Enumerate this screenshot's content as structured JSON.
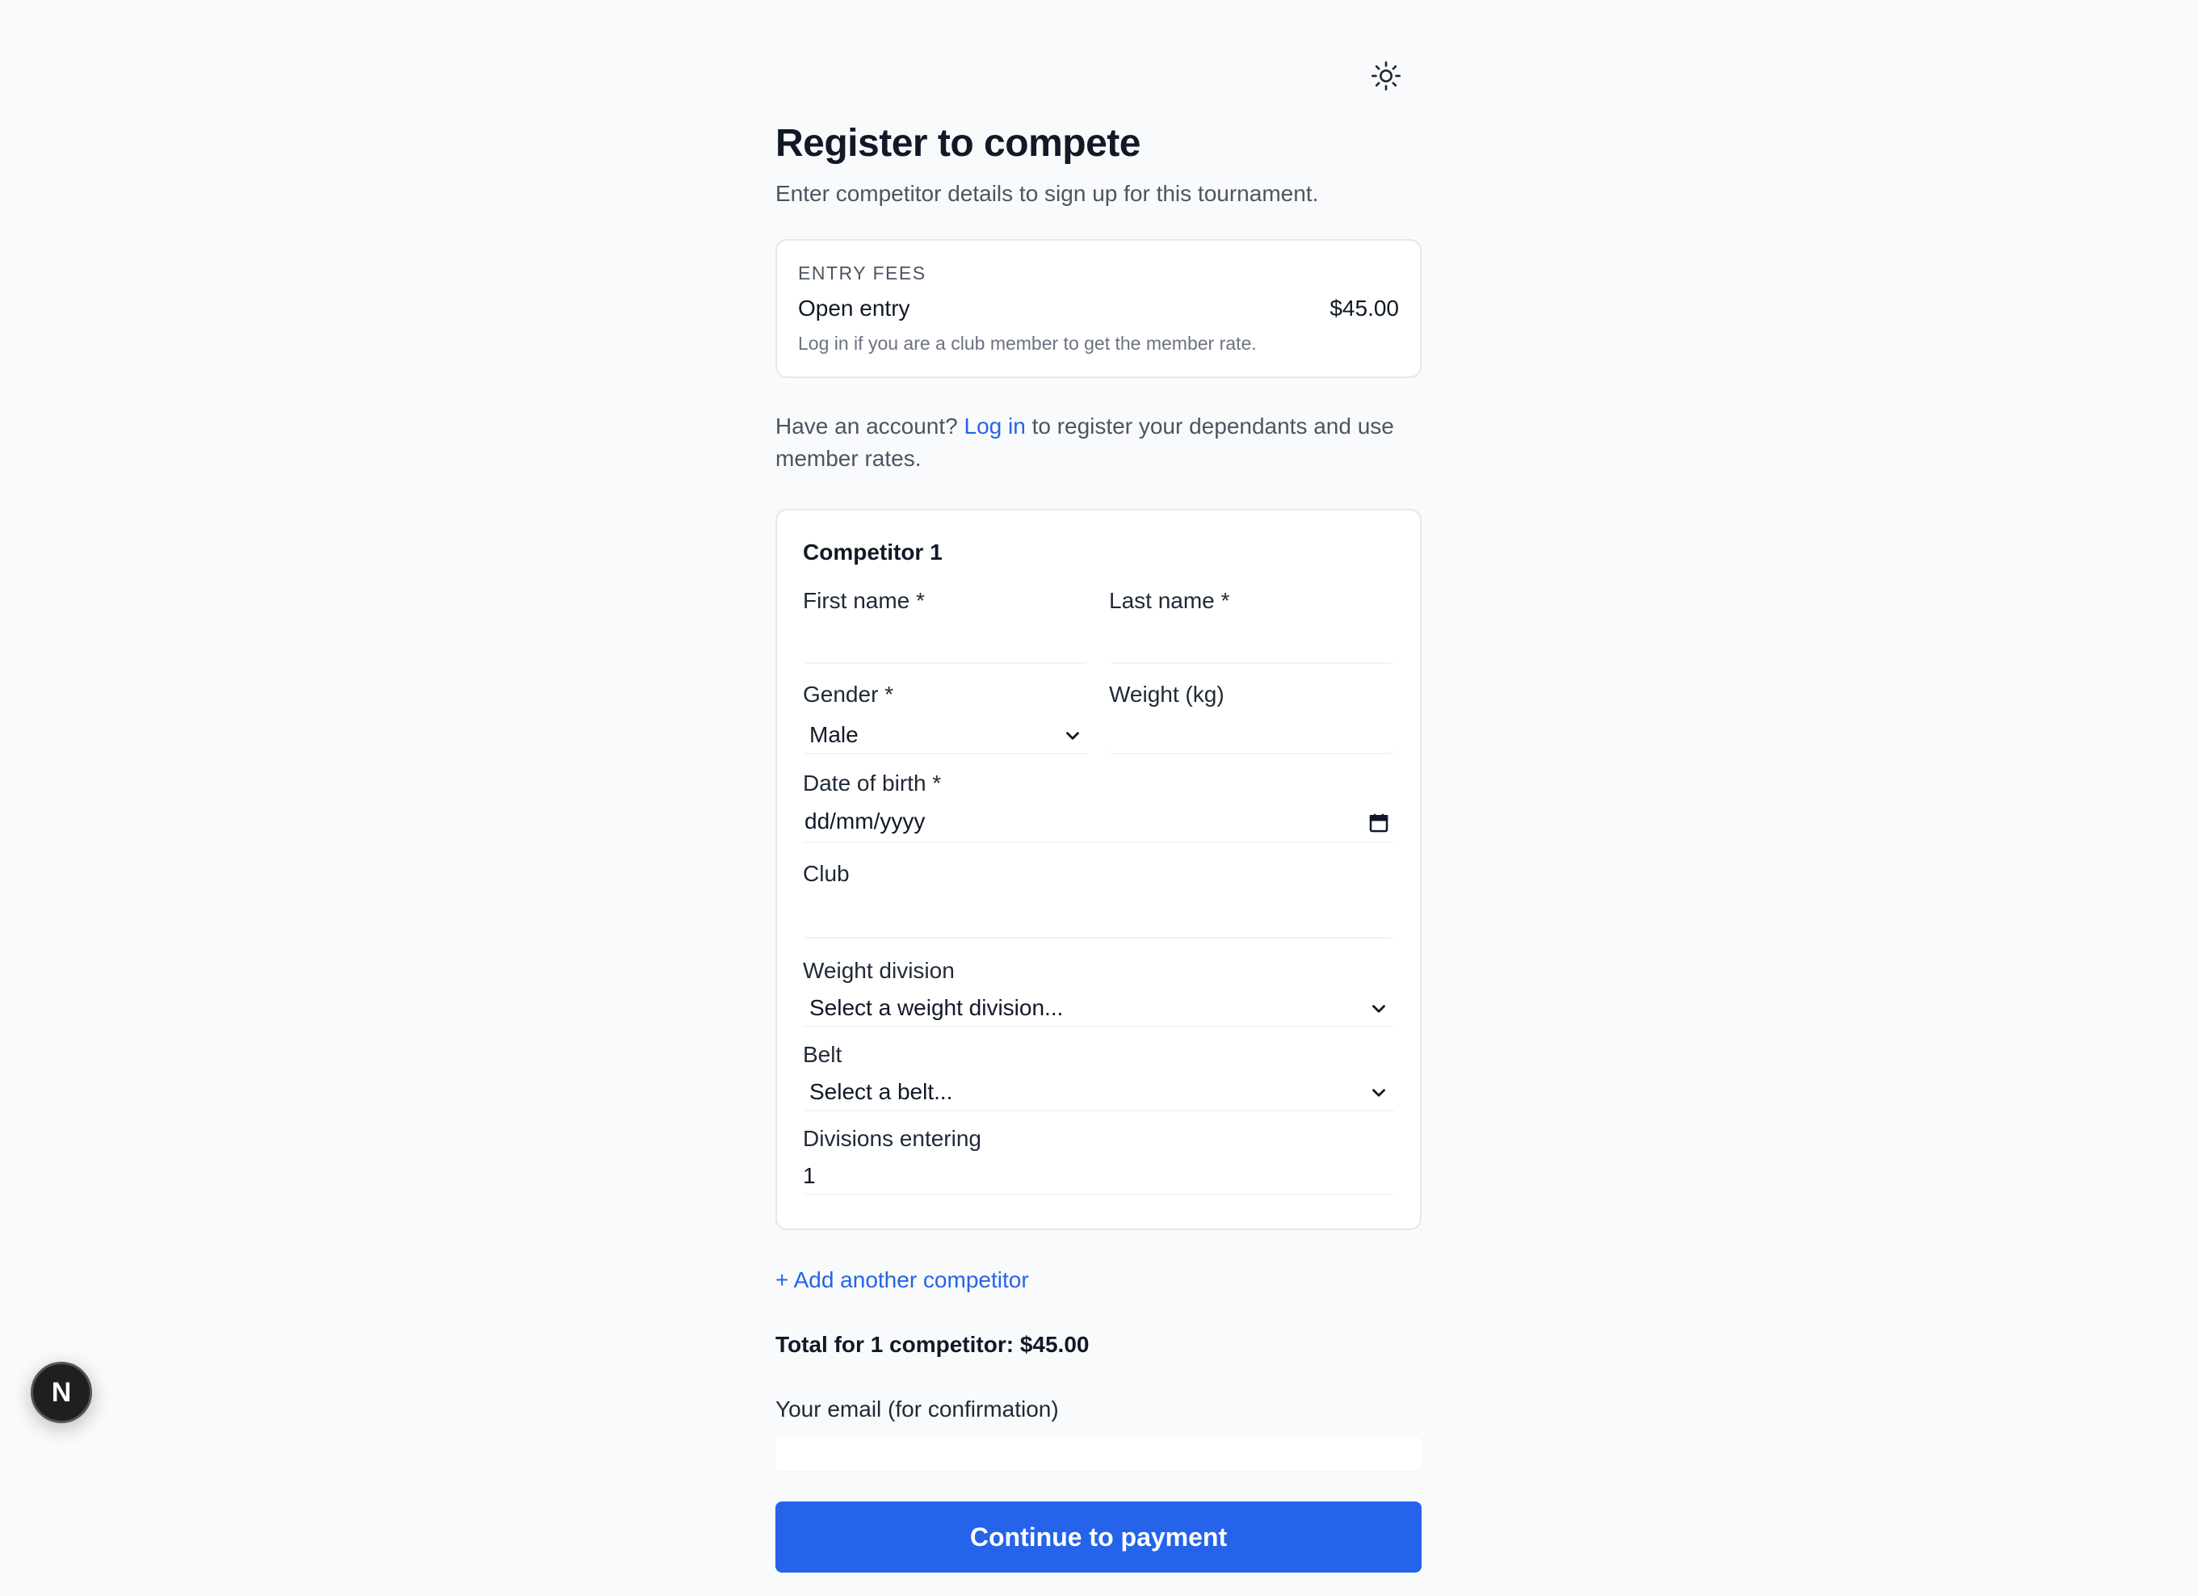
{
  "header": {
    "theme_toggle_icon": "sun-icon",
    "title": "Register to compete",
    "subtitle": "Enter competitor details to sign up for this tournament."
  },
  "fees": {
    "label": "ENTRY FEES",
    "item_name": "Open entry",
    "item_price": "$45.00",
    "note": "Log in if you are a club member to get the member rate."
  },
  "account": {
    "prefix": "Have an account?",
    "link": "Log in",
    "suffix": "to register your dependants and use member rates."
  },
  "competitor": {
    "title": "Competitor 1",
    "first_name_label": "First name *",
    "first_name_value": "",
    "last_name_label": "Last name *",
    "last_name_value": "",
    "gender_label": "Gender *",
    "gender_value": "Male",
    "weight_label": "Weight (kg)",
    "weight_value": "",
    "dob_label": "Date of birth *",
    "dob_placeholder": "dd/mm/yyyy",
    "club_label": "Club",
    "club_value": "",
    "weight_division_label": "Weight division",
    "weight_division_value": "Select a weight division...",
    "belt_label": "Belt",
    "belt_value": "Select a belt...",
    "divisions_label": "Divisions entering",
    "divisions_value": "1"
  },
  "actions": {
    "add_competitor": "+ Add another competitor",
    "total": "Total for 1 competitor: $45.00",
    "email_label": "Your email (for confirmation)",
    "email_value": "",
    "submit": "Continue to payment"
  },
  "badge": {
    "letter": "N"
  },
  "colors": {
    "accent": "#2563eb",
    "background": "#f9fafb",
    "card_border": "#e5e7eb"
  }
}
